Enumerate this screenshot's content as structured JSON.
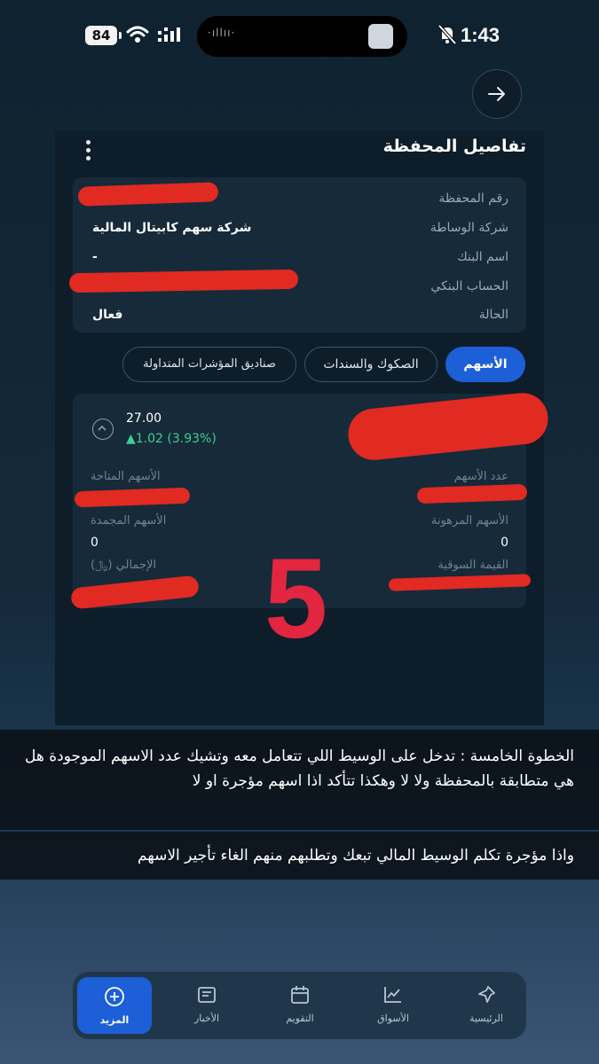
{
  "status_bar": {
    "battery": "84",
    "time": "1:43"
  },
  "header": {
    "title": "تفاصيل المحفظة"
  },
  "portfolio": {
    "rows": [
      {
        "label": "رقم المحفظة",
        "value": ""
      },
      {
        "label": "شركة الوساطة",
        "value": "شركة سهم كابيتال المالية"
      },
      {
        "label": "اسم البنك",
        "value": "-"
      },
      {
        "label": "الحساب البنكي",
        "value": ""
      },
      {
        "label": "الحالة",
        "value": "فعال"
      }
    ]
  },
  "tabs": [
    {
      "label": "الأسهم",
      "active": true
    },
    {
      "label": "الصكوك والسندات",
      "active": false
    },
    {
      "label": "صناديق المؤشرات المتداولة",
      "active": false
    }
  ],
  "stock": {
    "price": "27.00",
    "change": "▲1.02 (3.93%)",
    "shares_count_label": "عدد الأسهم",
    "available_label": "الأسهم المتاحة",
    "pledged_label": "الأسهم المرهونة",
    "pledged_value": "0",
    "frozen_label": "الأسهم المجمدة",
    "frozen_value": "0",
    "market_value_label": "القيمة السوقية",
    "total_label": "الإجمالي (﷼)"
  },
  "overlay": {
    "step_number": "5",
    "caption_1": "الخطوة الخامسة : تدخل على الوسيط اللي تتعامل معه وتشيك عدد الاسهم الموجودة هل هي متطابقة بالمحفظة ولا لا وهكذا تتأكد اذا اسهم مؤجرة او لا",
    "caption_2": "واذا مؤجرة تكلم الوسيط المالي تبعك وتطلبهم منهم الغاء تأجير الاسهم"
  },
  "nav": [
    {
      "label": "الرئيسية",
      "icon": "home-icon"
    },
    {
      "label": "الأسواق",
      "icon": "chart-icon"
    },
    {
      "label": "التقويم",
      "icon": "calendar-icon"
    },
    {
      "label": "الأخبار",
      "icon": "news-icon"
    },
    {
      "label": "المزيد",
      "icon": "plus-icon",
      "active": true
    }
  ],
  "colors": {
    "accent": "#1d5fd6",
    "positive": "#3ecf8e",
    "redaction": "#e02a22",
    "step_number": "#e3263f"
  }
}
